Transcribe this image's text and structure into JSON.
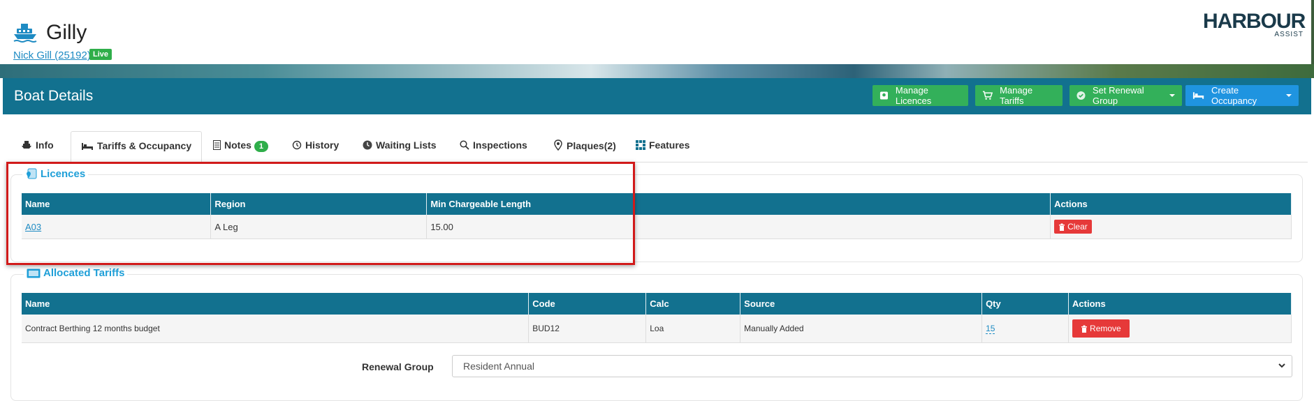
{
  "boat": {
    "name": "Gilly",
    "owner_link": "Nick Gill (25192)",
    "status_badge": "Live"
  },
  "logo": {
    "main": "HARBOUR",
    "sub": "ASSIST"
  },
  "panel": {
    "title": "Boat Details",
    "buttons": {
      "manage_licences": "Manage Licences",
      "manage_tariffs": "Manage Tariffs",
      "set_renewal_group": "Set Renewal Group",
      "create_occupancy": "Create Occupancy"
    }
  },
  "tabs": [
    {
      "label": "Info"
    },
    {
      "label": "Tariffs & Occupancy",
      "active": true
    },
    {
      "label": "Notes",
      "badge": "1"
    },
    {
      "label": "History"
    },
    {
      "label": "Waiting Lists"
    },
    {
      "label": "Inspections"
    },
    {
      "label": "Plaques(2)"
    },
    {
      "label": "Features"
    }
  ],
  "licences": {
    "legend": "Licences",
    "headers": [
      "Name",
      "Region",
      "Min Chargeable Length",
      "",
      "Actions"
    ],
    "rows": [
      {
        "name": "A03",
        "region": "A Leg",
        "min_length": "15.00",
        "action": "Clear"
      }
    ]
  },
  "tariffs": {
    "legend": "Allocated Tariffs",
    "headers": [
      "Name",
      "Code",
      "Calc",
      "Source",
      "Qty",
      "Actions"
    ],
    "rows": [
      {
        "name": "Contract Berthing 12 months budget",
        "code": "BUD12",
        "calc": "Loa",
        "source": "Manually Added",
        "qty": "15",
        "action": "Remove"
      }
    ]
  },
  "renewal_group": {
    "label": "Renewal Group",
    "value": "Resident Annual"
  },
  "colors": {
    "primary": "#12718f",
    "green": "#33b05a",
    "blue": "#1f94e0",
    "red": "#e63939",
    "highlight": "#d11a1a"
  }
}
